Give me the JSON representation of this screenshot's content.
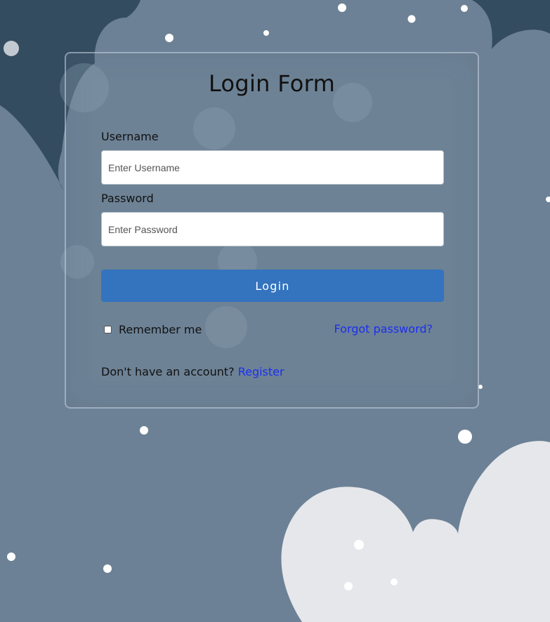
{
  "form": {
    "title": "Login Form",
    "username_label": "Username",
    "username_placeholder": "Enter Username",
    "password_label": "Password",
    "password_placeholder": "Enter Password",
    "login_label": "Login",
    "remember_label": "Remember me",
    "remember_checked": false,
    "forgot_label": "Forgot password?",
    "no_account_text": "Don't have an account?",
    "register_label": "Register"
  },
  "colors": {
    "background": "#6c8195",
    "dark_shape": "#344c60",
    "cloud": "#e6e7eb",
    "button": "#3473be",
    "link": "#1a2ff0"
  }
}
